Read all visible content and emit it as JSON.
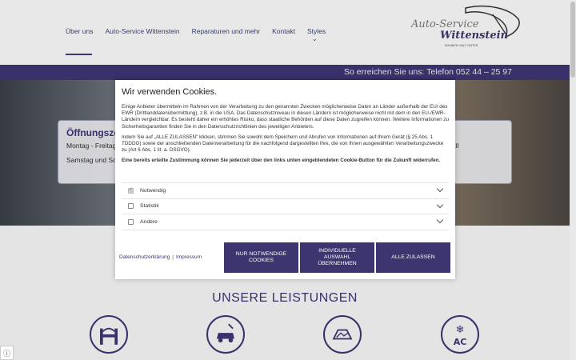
{
  "nav": {
    "items": [
      "Über uns",
      "Auto-Service Wittenstein",
      "Reparaturen und mehr",
      "Kontakt",
      "Styles"
    ]
  },
  "logo": {
    "line1": "Auto-Service",
    "line2": "Wittenstein",
    "tagline": "INHABER: RALF REITER"
  },
  "topbar": {
    "text": "So erreichen Sie uns: Telefon 052 44 – 25 97"
  },
  "hero": {
    "left_title": "Öffnungszei",
    "left_line1": "Montag - Freitag",
    "left_line2": "Samstag und So",
    "right_title": "ein",
    "right_line1": "ensell",
    "right_line2": "e"
  },
  "modal": {
    "title": "Wir verwenden Cookies.",
    "para1": "Einige Anbieter übermitteln im Rahmen von der Verarbeitung zu den genannten Zwecken möglicherweise Daten an Länder außerhalb der EU/ des EWR (Drittlanddatenübermittlung), z.B. in die USA. Das Datenschutzniveau in diesen Ländern ist möglicherweise nicht mit dem in den EU-/EWR-Ländern vergleichbar. Es besteht daher ein erhöhtes Risiko, dass staatliche Behörden auf diese Daten zugreifen können. Weitere Informationen zu Sicherheitsgarantien finden Sie in den Datenschutzrichtlinien des jeweiligen Anbieters.",
    "para2": "Indem Sie auf „ALLE ZULASSEN\" klicken, stimmen Sie sowohl dem Speichern und Abrufen von Informationen auf Ihrem Gerät (§ 25 Abs. 1 TDDDG) sowie der anschließenden Datenverarbeitung für die nachfolgend dargestellten Ihre, die von Ihnen ausgewählten Verarbeitungszwecke zu (Art 6 Abs. 1 lit. a. DSGVO).",
    "para3": "Eine bereits erteilte Zustimmung können Sie jederzeit über den links unten eingeblendeten Cookie-Button für die Zukunft widerrufen.",
    "categories": [
      "Notwendig",
      "Statistik",
      "Andere"
    ],
    "link_privacy": "Datenschutzerklärung",
    "link_separator": "|",
    "link_imprint": "Impressum",
    "btn_necessary": "NUR NOTWENDIGE COOKIES",
    "btn_individual": "INDIVIDUELLE AUSWAHL ÜBERNEHMEN",
    "btn_all": "ALLE ZULASSEN"
  },
  "services": {
    "title": "UNSERE LEISTUNGEN",
    "ac_label": "AC"
  },
  "corner_badge": "ⓘ",
  "colors": {
    "brand": "#3d3570",
    "topbar": "#3d3570"
  }
}
